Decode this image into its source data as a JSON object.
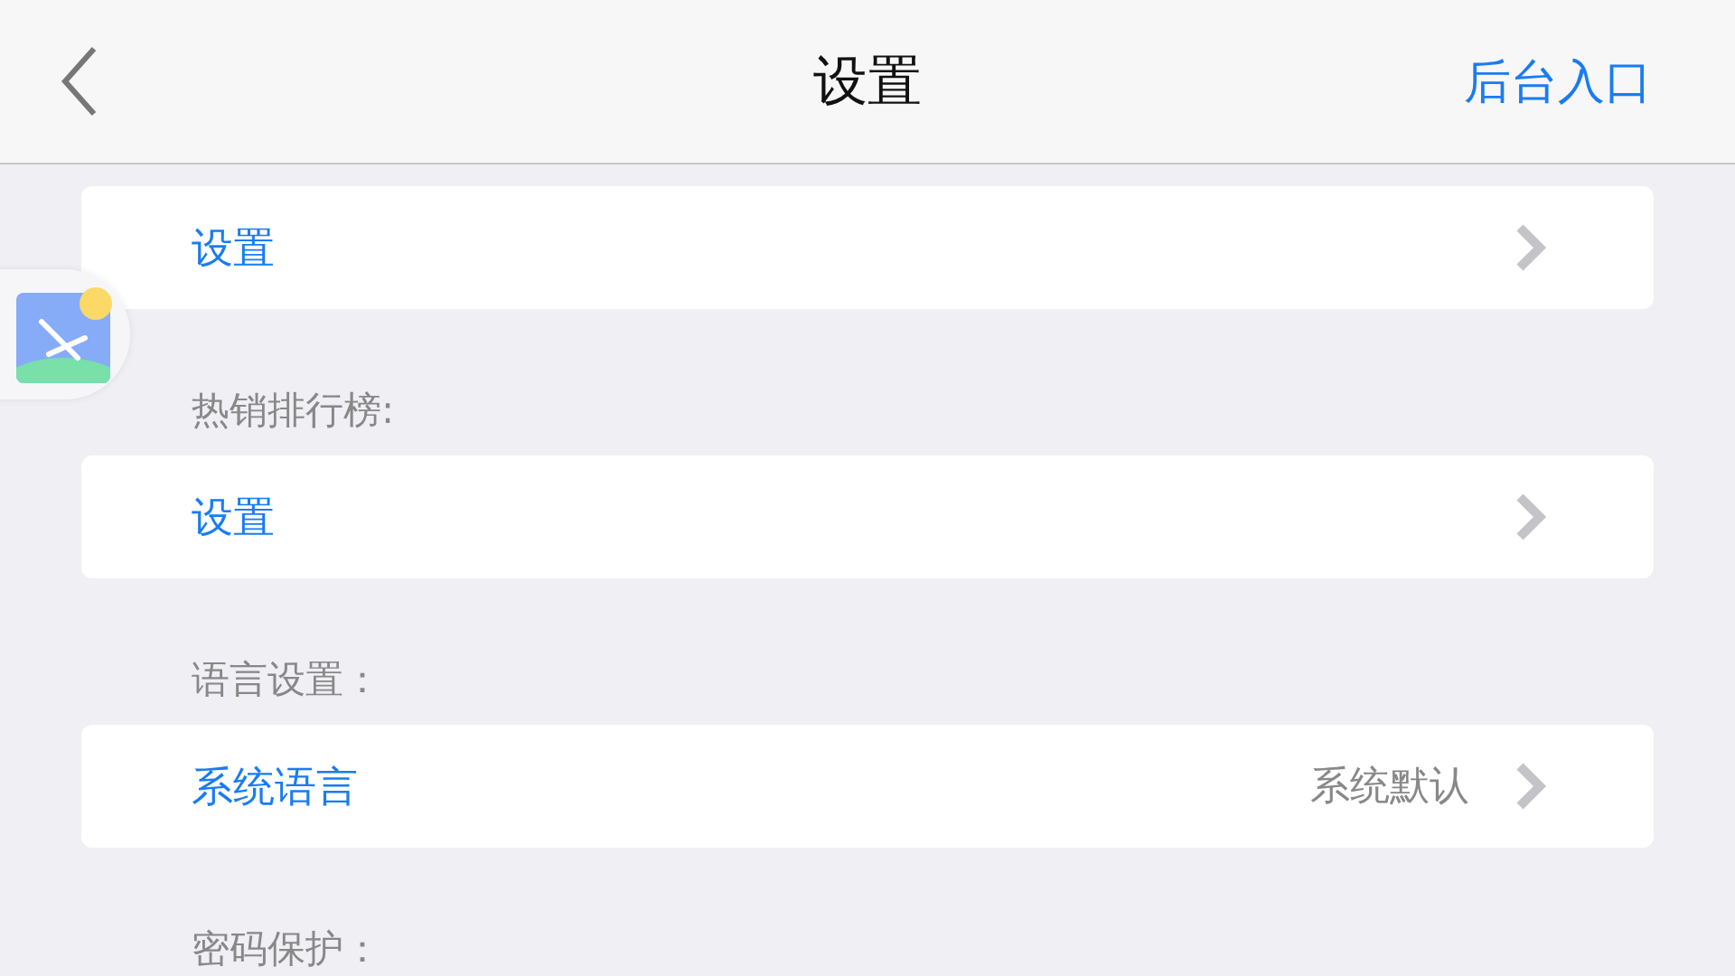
{
  "header": {
    "title": "设置",
    "action": "后台入口"
  },
  "sections": [
    {
      "rows": [
        {
          "title": "设置"
        }
      ]
    },
    {
      "label": "热销排行榜:",
      "rows": [
        {
          "title": "设置"
        }
      ]
    },
    {
      "label": "语言设置：",
      "rows": [
        {
          "title": "系统语言",
          "value": "系统默认"
        }
      ]
    },
    {
      "label": "密码保护："
    }
  ]
}
